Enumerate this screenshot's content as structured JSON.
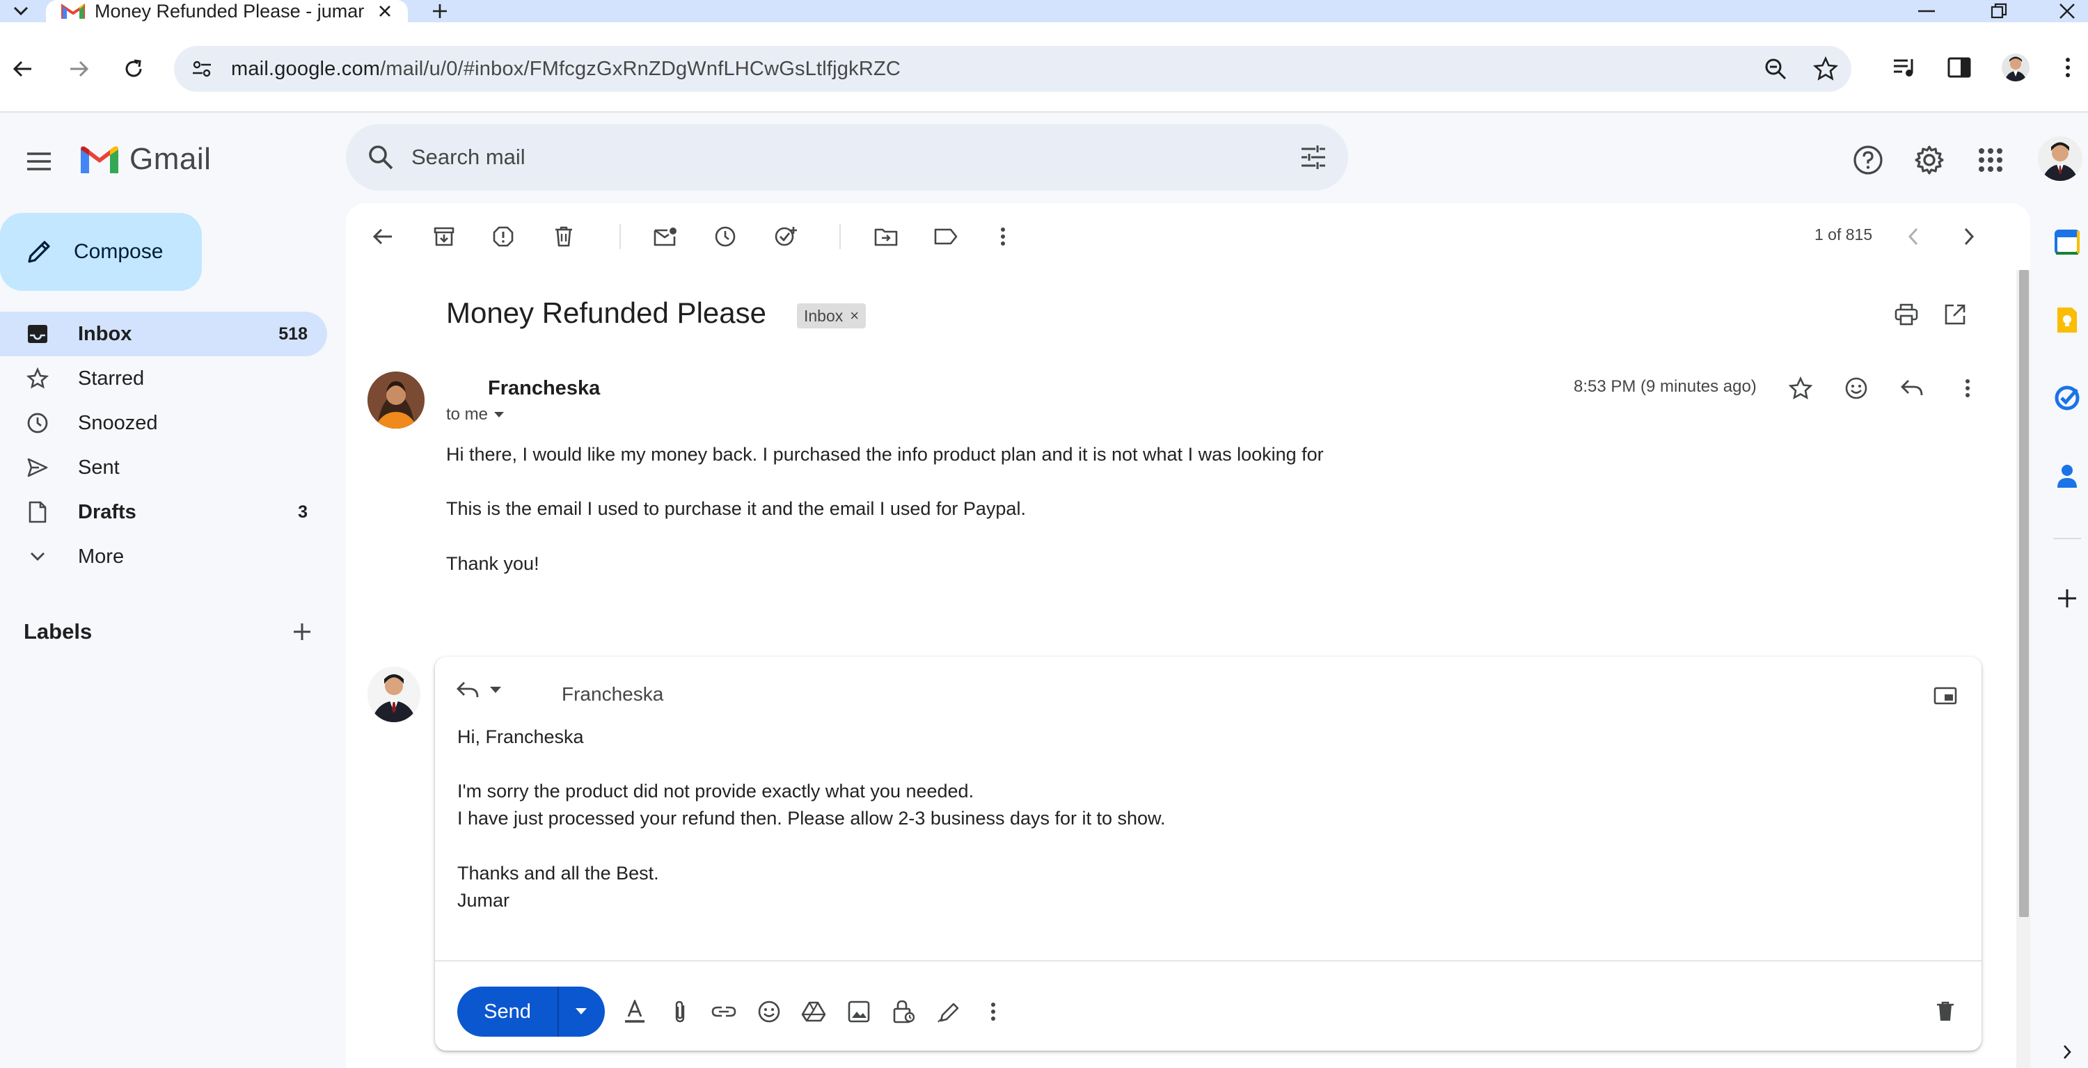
{
  "browser": {
    "tab_title": "Money Refunded Please - jumar",
    "url_host": "mail.google.com",
    "url_rest": "/mail/u/0/#inbox/FMfcgzGxRnZDgWnfLHCwGsLtlfjgkRZC"
  },
  "header": {
    "logo_text": "Gmail",
    "search_placeholder": "Search mail"
  },
  "sidebar": {
    "compose_label": "Compose",
    "items": [
      {
        "label": "Inbox",
        "count": "518",
        "icon": "inbox-icon"
      },
      {
        "label": "Starred",
        "count": "",
        "icon": "star-icon"
      },
      {
        "label": "Snoozed",
        "count": "",
        "icon": "clock-icon"
      },
      {
        "label": "Sent",
        "count": "",
        "icon": "send-icon"
      },
      {
        "label": "Drafts",
        "count": "3",
        "icon": "draft-icon"
      },
      {
        "label": "More",
        "count": "",
        "icon": "chevron-down-icon"
      }
    ],
    "labels_title": "Labels"
  },
  "toolbar": {
    "pager": "1 of 815"
  },
  "message": {
    "subject": "Money Refunded Please",
    "label_chip": "Inbox",
    "label_chip_close": "×",
    "sender_name": "Francheska",
    "to_line": "to me",
    "timestamp": "8:53 PM (9 minutes ago)",
    "body": [
      "Hi there, I would like my money back. I purchased the info product plan and it is not what I was looking for",
      "This is the email I used to purchase it and the email I used for Paypal.",
      "Thank you!"
    ]
  },
  "reply": {
    "recipient": "Francheska",
    "lines": [
      "Hi, Francheska",
      "I'm sorry the product did not provide exactly what you needed.",
      "I have just processed your refund then. Please allow 2-3 business days for it to show.",
      "Thanks and all the Best.",
      "Jumar"
    ],
    "send_label": "Send"
  },
  "colors": {
    "accent_blue": "#0b57d0",
    "compose_bg": "#c2e7ff",
    "active_nav_bg": "#d3e3fd",
    "app_bg": "#f6f8fc"
  }
}
